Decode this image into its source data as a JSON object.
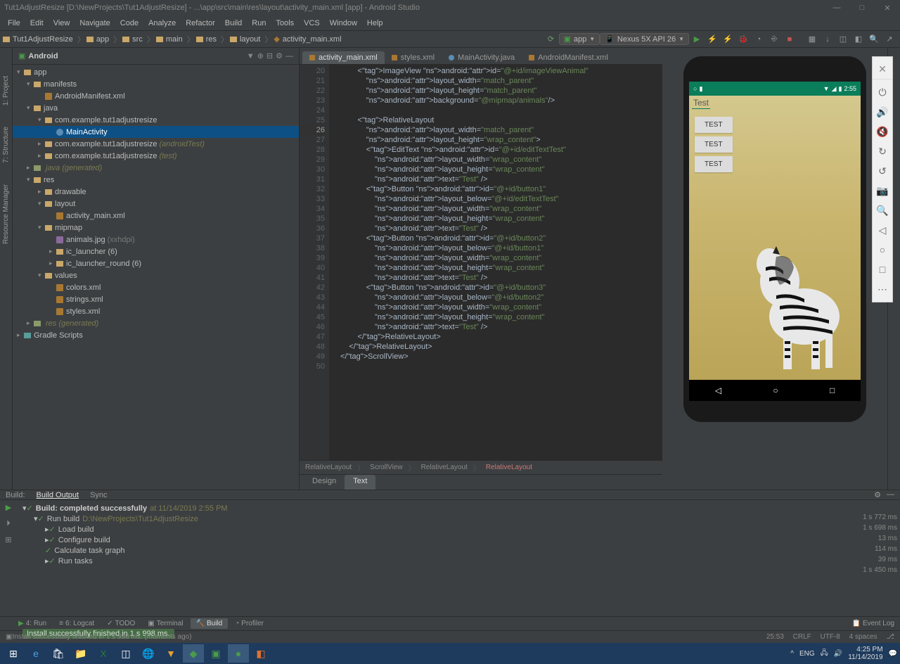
{
  "window": {
    "title": "Tut1AdjustResize [D:\\NewProjects\\Tut1AdjustResize] - ...\\app\\src\\main\\res\\layout\\activity_main.xml [app] - Android Studio",
    "controls": {
      "min": "—",
      "max": "□",
      "close": "✕"
    }
  },
  "menu": [
    "File",
    "Edit",
    "View",
    "Navigate",
    "Code",
    "Analyze",
    "Refactor",
    "Build",
    "Run",
    "Tools",
    "VCS",
    "Window",
    "Help"
  ],
  "nav": {
    "crumbs": [
      "Tut1AdjustResize",
      "app",
      "src",
      "main",
      "res",
      "layout",
      "activity_main.xml"
    ],
    "runConfig": "app",
    "device": "Nexus 5X API 26"
  },
  "projectPanel": {
    "title": "Android",
    "tree": {
      "app": "app",
      "manifests": "manifests",
      "manifestFile": "AndroidManifest.xml",
      "java": "java",
      "pkg": "com.example.tut1adjustresize",
      "mainActivity": "MainActivity",
      "pkgAndroidTest": "com.example.tut1adjustresize",
      "pkgAndroidTestGen": "(androidTest)",
      "pkgTest": "com.example.tut1adjustresize",
      "pkgTestGen": "(test)",
      "javaGen": "java",
      "javaGenSuffix": "(generated)",
      "res": "res",
      "drawable": "drawable",
      "layout": "layout",
      "activityMain": "activity_main.xml",
      "mipmap": "mipmap",
      "animals": "animals.jpg",
      "animalsDim": "(xxhdpi)",
      "icLauncher": "ic_launcher (6)",
      "icLauncherRound": "ic_launcher_round (6)",
      "values": "values",
      "colors": "colors.xml",
      "strings": "strings.xml",
      "styles": "styles.xml",
      "resGen": "res",
      "resGenSuffix": "(generated)",
      "gradle": "Gradle Scripts"
    }
  },
  "editor": {
    "tabs": [
      {
        "label": "activity_main.xml",
        "active": true
      },
      {
        "label": "styles.xml",
        "active": false
      },
      {
        "label": "MainActivity.java",
        "active": false,
        "java": true
      },
      {
        "label": "AndroidManifest.xml",
        "active": false
      }
    ],
    "lineStart": 20,
    "highlightedLine": 26,
    "breadcrumb": [
      "RelativeLayout",
      "ScrollView",
      "RelativeLayout",
      "RelativeLayout"
    ],
    "designTabs": [
      "Design",
      "Text"
    ],
    "activeDesignTab": "Text"
  },
  "code": {
    "lines": [
      "          <ImageView android:id=\"@+id/imageViewAnimal\"",
      "              android:layout_width=\"match_parent\"",
      "              android:layout_height=\"match_parent\"",
      "              android:background=\"@mipmap/animals\"/>",
      "",
      "          <RelativeLayout",
      "              android:layout_width=\"match_parent\"",
      "              android:layout_height=\"wrap_content\">",
      "              <EditText android:id=\"@+id/editTextTest\"",
      "                  android:layout_width=\"wrap_content\"",
      "                  android:layout_height=\"wrap_content\"",
      "                  android:text=\"Test\" />",
      "              <Button android:id=\"@+id/button1\"",
      "                  android:layout_below=\"@+id/editTextTest\"",
      "                  android:layout_width=\"wrap_content\"",
      "                  android:layout_height=\"wrap_content\"",
      "                  android:text=\"Test\" />",
      "              <Button android:id=\"@+id/button2\"",
      "                  android:layout_below=\"@+id/button1\"",
      "                  android:layout_width=\"wrap_content\"",
      "                  android:layout_height=\"wrap_content\"",
      "                  android:text=\"Test\" />",
      "              <Button android:id=\"@+id/button3\"",
      "                  android:layout_below=\"@+id/button2\"",
      "                  android:layout_width=\"wrap_content\"",
      "                  android:layout_height=\"wrap_content\"",
      "                  android:text=\"Test\" />",
      "          </RelativeLayout>",
      "      </RelativeLayout>",
      "  </ScrollView>",
      ""
    ]
  },
  "bottomPanel": {
    "tabs": [
      "Build:",
      "Build Output",
      "Sync"
    ],
    "activeTab": "Build Output",
    "build": {
      "root": "Build: completed successfully",
      "rootTime": "at 11/14/2019 2:55 PM",
      "runBuild": "Run build",
      "runBuildPath": "D:\\NewProjects\\Tut1AdjustResize",
      "loadBuild": "Load build",
      "configBuild": "Configure build",
      "taskGraph": "Calculate task graph",
      "runTasks": "Run tasks"
    },
    "timings": [
      "",
      "1 s 772 ms",
      "1 s 698 ms",
      "13 ms",
      "114 ms",
      "39 ms",
      "1 s 450 ms"
    ]
  },
  "toolTabs": {
    "run": "4: Run",
    "logcat": "6: Logcat",
    "todo": "TODO",
    "terminal": "Terminal",
    "build": "Build",
    "profiler": "Profiler",
    "eventLog": "Event Log"
  },
  "leftGutter": [
    "1: Project",
    "7: Structure",
    "Resource Manager"
  ],
  "status": {
    "install": "Install successfully finished in 1 s 998 ms.",
    "msg": "Install successfully finished in 1 s 998 ms. (moments ago)",
    "pos": "25:53",
    "crlf": "CRLF",
    "enc": "UTF-8",
    "spaces": "4 spaces",
    "branch": "⎇"
  },
  "emulator": {
    "statusTime": "2:55",
    "editText": "Test",
    "buttons": [
      "TEST",
      "TEST",
      "TEST"
    ],
    "toolbar": [
      "✕",
      "⏻",
      "🔊",
      "🔇",
      "↻",
      "↺",
      "📷",
      "🔍",
      "◁",
      "○",
      "□",
      "⋯"
    ]
  },
  "taskbar": {
    "lang": "ENG",
    "time": "4:25 PM",
    "date": "11/14/2019"
  }
}
